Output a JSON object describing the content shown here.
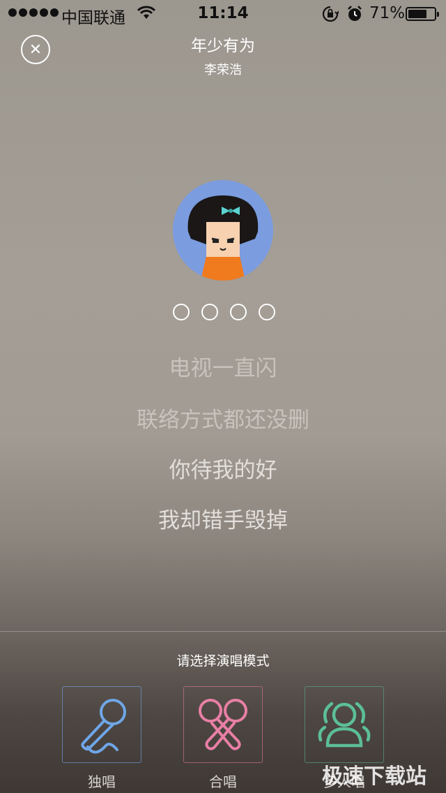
{
  "status_bar": {
    "carrier": "中国联通",
    "time": "11:14",
    "battery_percent": "71%",
    "battery_level": 0.71,
    "icons": [
      "signal-dots-icon",
      "wifi-icon",
      "rotation-lock-icon",
      "alarm-icon",
      "battery-icon"
    ]
  },
  "header": {
    "close_icon": "close-icon",
    "song_title": "年少有为",
    "artist": "李荣浩"
  },
  "countdown_dots": 4,
  "lyrics": [
    "电视一直闪",
    "联络方式都还没删",
    "你待我的好",
    "我却错手毁掉"
  ],
  "mode_select": {
    "prompt": "请选择演唱模式",
    "modes": [
      {
        "label": "独唱",
        "icon": "microphone-icon",
        "color": "#6fa6e8"
      },
      {
        "label": "合唱",
        "icon": "two-microphones-icon",
        "color": "#e87fa5"
      },
      {
        "label": "多人唱",
        "icon": "people-icon",
        "color": "#5cbf96"
      }
    ]
  },
  "watermark": "极速下载站"
}
